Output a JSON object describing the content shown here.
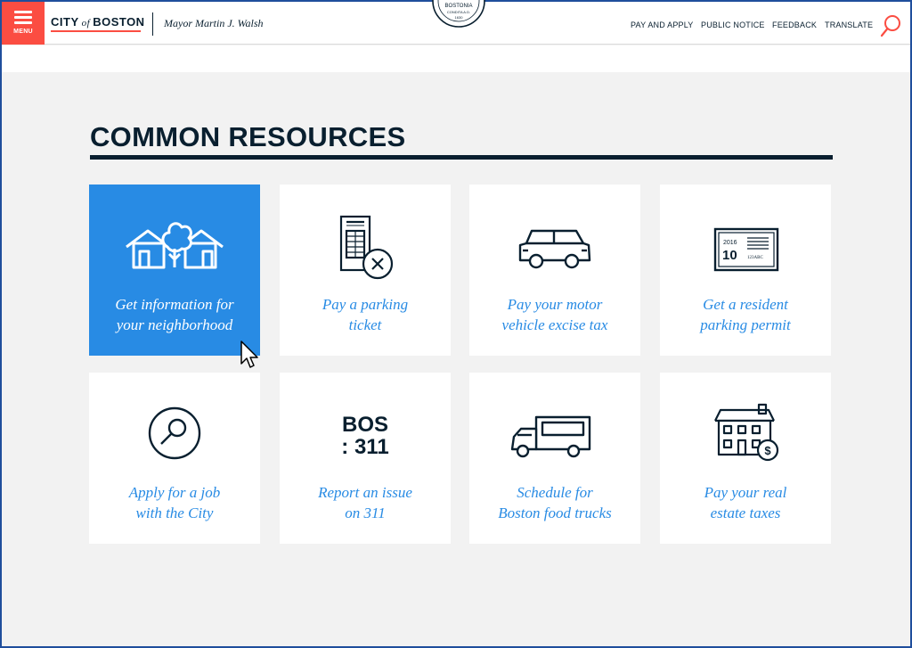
{
  "header": {
    "menu_label": "MENU",
    "logo_city": "CITY",
    "logo_of": "of",
    "logo_boston": "BOSTON",
    "mayor": "Mayor Martin J. Walsh",
    "seal_text": "BOSTONIA",
    "seal_sub": "CONDITA A.D.",
    "seal_year": "1630",
    "nav": [
      "PAY AND APPLY",
      "PUBLIC NOTICE",
      "FEEDBACK",
      "TRANSLATE"
    ]
  },
  "section": {
    "title": "COMMON RESOURCES"
  },
  "cards": [
    {
      "icon": "neighborhood-icon",
      "line1": "Get information for",
      "line2": "your neighborhood",
      "active": true
    },
    {
      "icon": "parking-ticket-icon",
      "line1": "Pay a parking",
      "line2": "ticket"
    },
    {
      "icon": "car-icon",
      "line1": "Pay your motor",
      "line2": "vehicle excise tax"
    },
    {
      "icon": "parking-permit-icon",
      "line1": "Get a resident",
      "line2": "parking permit",
      "permit_year": "2016",
      "permit_num": "10",
      "permit_plate": "123ABC"
    },
    {
      "icon": "job-search-icon",
      "line1": "Apply for a job",
      "line2": "with the City"
    },
    {
      "icon": "bos311-icon",
      "line1": "Report an issue",
      "line2": "on 311",
      "logo_top": "BOS",
      "logo_bottom": ": 311"
    },
    {
      "icon": "food-truck-icon",
      "line1": "Schedule for",
      "line2": "Boston food trucks"
    },
    {
      "icon": "property-tax-icon",
      "line1": "Pay your real",
      "line2": "estate taxes"
    }
  ],
  "colors": {
    "accent_red": "#fb4d42",
    "navy": "#091f2f",
    "blue": "#288be4",
    "background": "#f2f2f2"
  }
}
